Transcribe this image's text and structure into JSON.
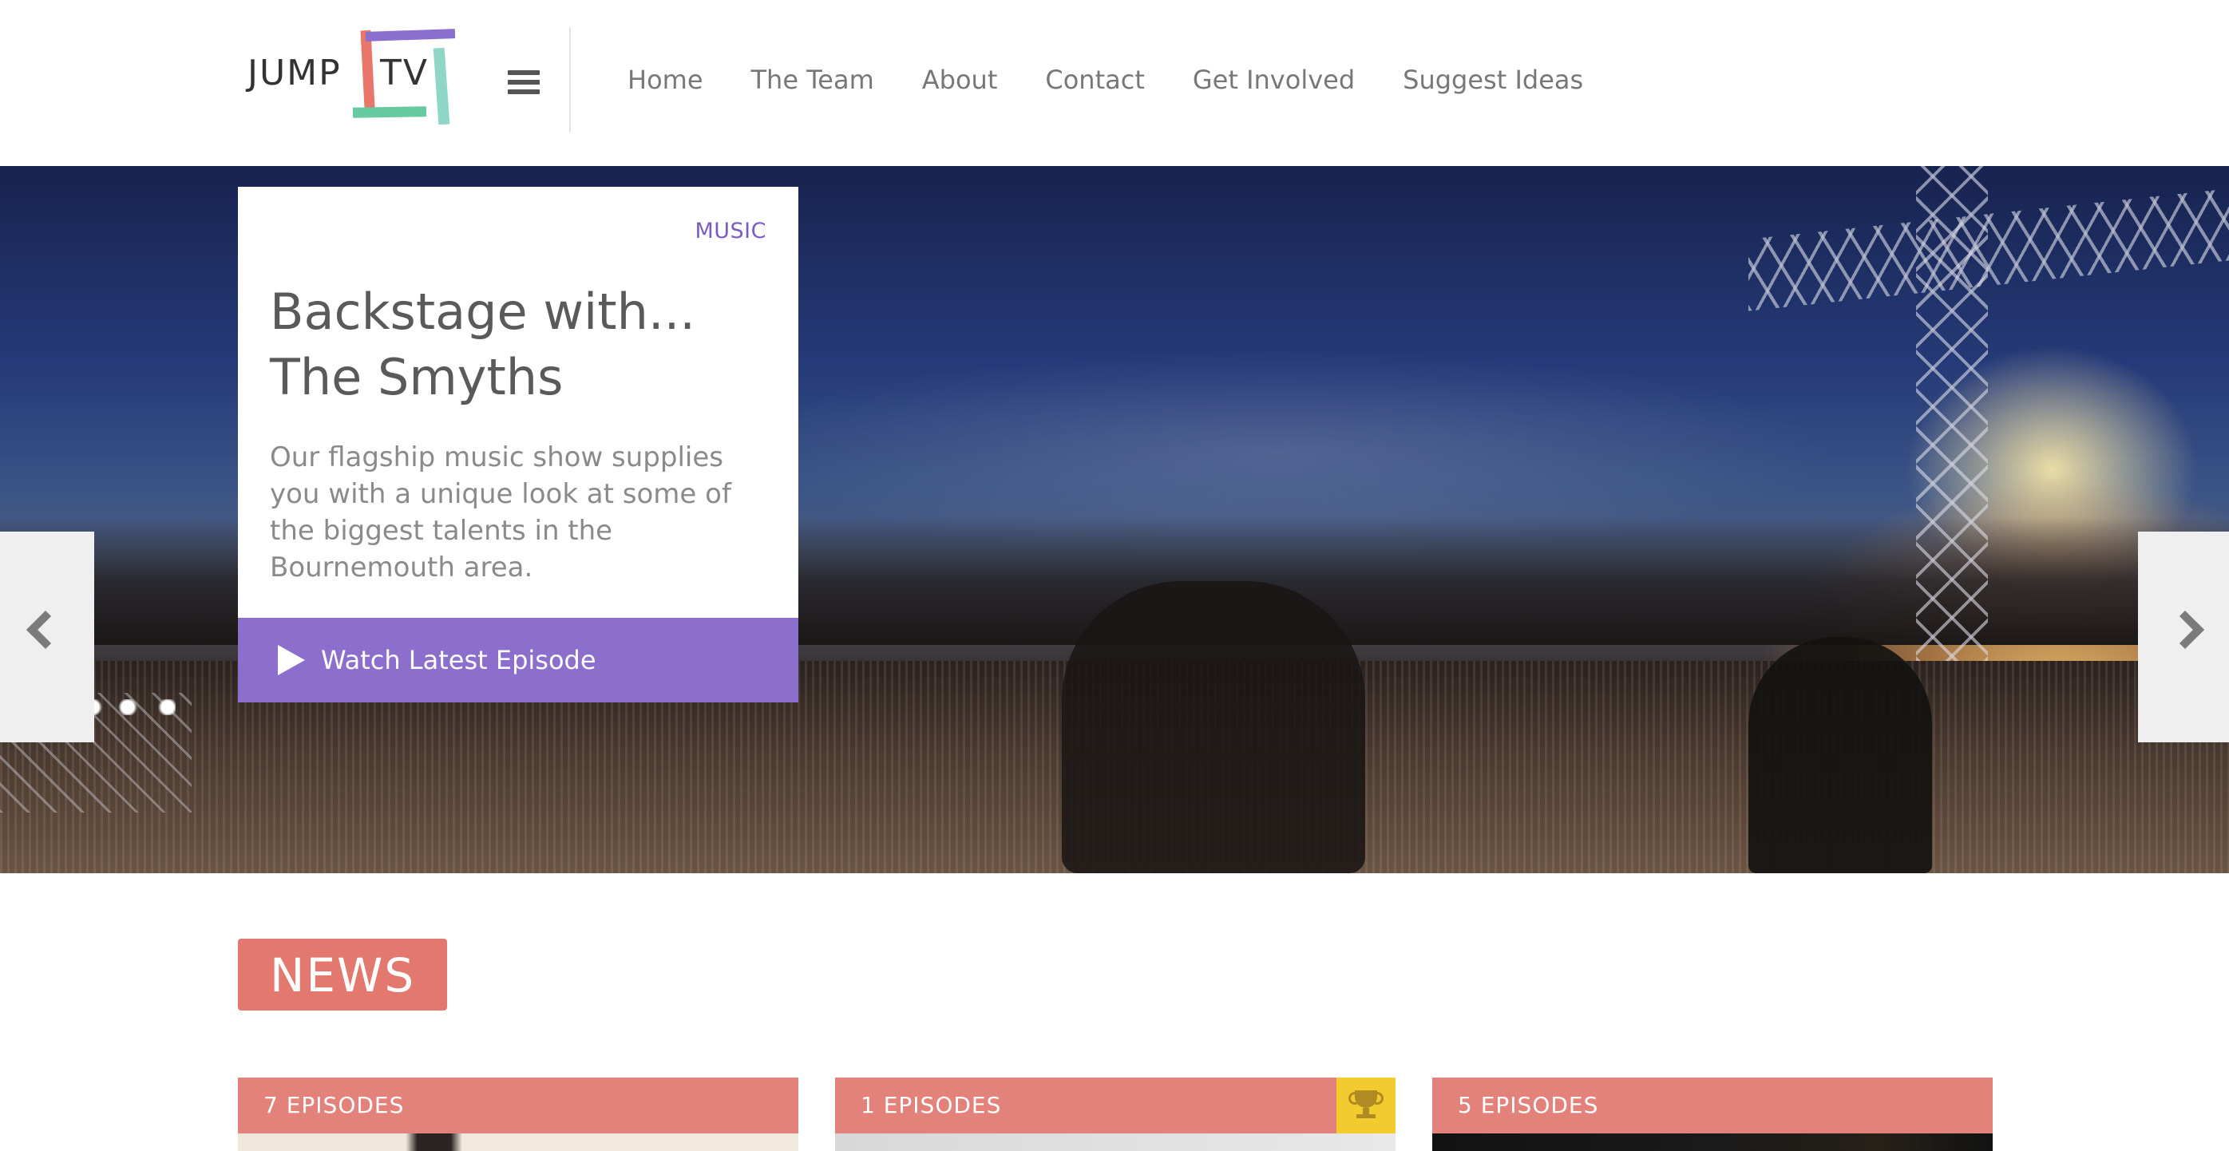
{
  "brand": {
    "logo_left": "JUMP",
    "logo_right": "TV",
    "colors": {
      "purple": "#8a6fcf",
      "orange": "#e8766a",
      "teal": "#8ed7c8",
      "green": "#67c9a0"
    }
  },
  "header": {
    "menu_icon": "hamburger-icon",
    "nav": [
      {
        "label": "Home"
      },
      {
        "label": "The Team"
      },
      {
        "label": "About"
      },
      {
        "label": "Contact"
      },
      {
        "label": "Get Involved"
      },
      {
        "label": "Suggest Ideas"
      }
    ]
  },
  "hero": {
    "category": "MUSIC",
    "title_line1": "Backstage with...",
    "title_line2": "The Smyths",
    "description": "Our flagship music show supplies you with a unique look at some of the biggest talents in the Bournemouth area.",
    "cta_label": "Watch Latest Episode",
    "cta_icon": "play-icon",
    "prev_icon": "chevron-left-icon",
    "next_icon": "chevron-right-icon",
    "accent_color": "#8c6fcd"
  },
  "news": {
    "heading": "NEWS",
    "heading_color": "#e2786e",
    "tiles": [
      {
        "label": "7 EPISODES",
        "award": false
      },
      {
        "label": "1 EPISODES",
        "award": true,
        "award_icon": "trophy-icon"
      },
      {
        "label": "5 EPISODES",
        "award": false
      }
    ]
  }
}
